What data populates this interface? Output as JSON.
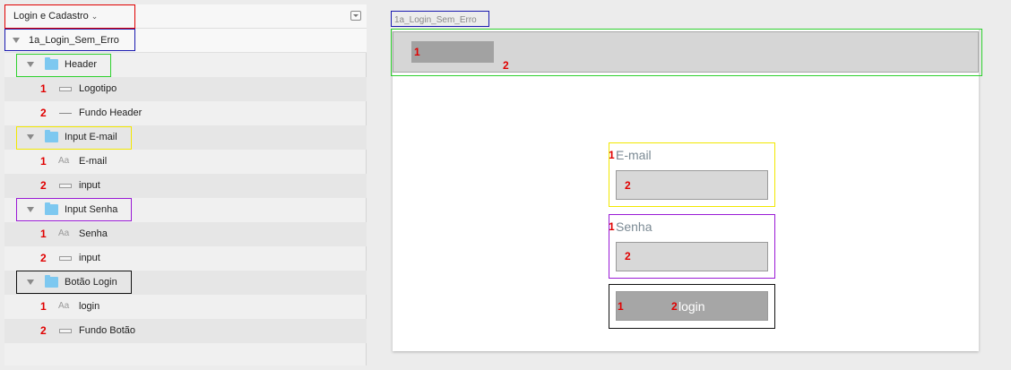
{
  "page_selector": {
    "label": "Login e Cadastro",
    "chevron_icon": "chevron-down-icon"
  },
  "layers": {
    "artboard": {
      "label": "1a_Login_Sem_Erro"
    },
    "header": {
      "label": "Header",
      "children": [
        {
          "num": "1",
          "label": "Logotipo",
          "icon": "rectangle-icon"
        },
        {
          "num": "2",
          "label": "Fundo Header",
          "icon": "line-icon"
        }
      ]
    },
    "input_email": {
      "label": "Input E-mail",
      "children": [
        {
          "num": "1",
          "label": "E-mail",
          "icon": "text-icon",
          "icon_text": "Aa"
        },
        {
          "num": "2",
          "label": "input",
          "icon": "rectangle-icon"
        }
      ]
    },
    "input_senha": {
      "label": "Input Senha",
      "children": [
        {
          "num": "1",
          "label": "Senha",
          "icon": "text-icon",
          "icon_text": "Aa"
        },
        {
          "num": "2",
          "label": "input",
          "icon": "rectangle-icon"
        }
      ]
    },
    "botao_login": {
      "label": "Botão Login",
      "children": [
        {
          "num": "1",
          "label": "login",
          "icon": "text-icon",
          "icon_text": "Aa"
        },
        {
          "num": "2",
          "label": "Fundo Botão",
          "icon": "rectangle-icon"
        }
      ]
    }
  },
  "canvas": {
    "artboard_label": "1a_Login_Sem_Erro",
    "header": {
      "logo_num": "1",
      "bg_num": "2"
    },
    "email": {
      "label_num": "1",
      "label": "E-mail",
      "input_num": "2"
    },
    "senha": {
      "label_num": "1",
      "label": "Senha",
      "input_num": "2"
    },
    "login_button": {
      "text_num": "1",
      "bg_num": "2",
      "text": "login"
    }
  },
  "colors": {
    "annotation_number": "#e00000",
    "highlight_red": "#e00000",
    "highlight_blue": "#1a1ab0",
    "highlight_green": "#2fd12f",
    "highlight_yellow": "#f2e800",
    "highlight_purple": "#9a1ad6",
    "highlight_black": "#111111",
    "folder": "#7dc8f0"
  }
}
